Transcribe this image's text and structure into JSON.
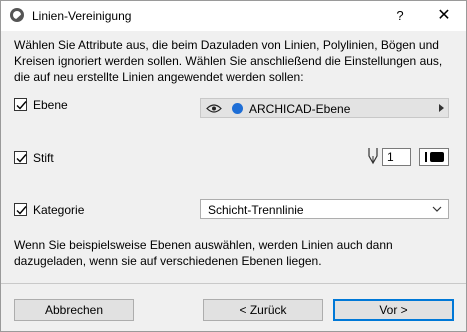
{
  "window": {
    "title": "Linien-Vereinigung",
    "help_label": "?",
    "close_label": "✕"
  },
  "description": "Wählen Sie Attribute aus, die beim Dazuladen von Linien, Polylinien, Bögen und Kreisen ignoriert werden sollen. Wählen Sie anschließend die Einstellungen aus, die auf neu erstellte Linien angewendet werden sollen:",
  "rows": {
    "ebene": {
      "label": "Ebene",
      "checked": true,
      "value": "ARCHICAD-Ebene"
    },
    "stift": {
      "label": "Stift",
      "checked": true,
      "pen_number": "1"
    },
    "kategorie": {
      "label": "Kategorie",
      "checked": true,
      "value": "Schicht-Trennlinie"
    }
  },
  "note": "Wenn Sie beispielsweise Ebenen auswählen, werden Linien auch dann dazugeladen, wenn sie auf verschiedenen Ebenen liegen.",
  "buttons": {
    "cancel": "Abbrechen",
    "back": "< Zurück",
    "next": "Vor >"
  },
  "colors": {
    "accent": "#0078d7",
    "layer_logo": "#1e6ed6"
  },
  "icons": [
    "app-icon",
    "eye-icon",
    "layer-icon",
    "pen-icon",
    "chevron-down-icon",
    "chevron-right-icon",
    "checkmark-icon"
  ]
}
